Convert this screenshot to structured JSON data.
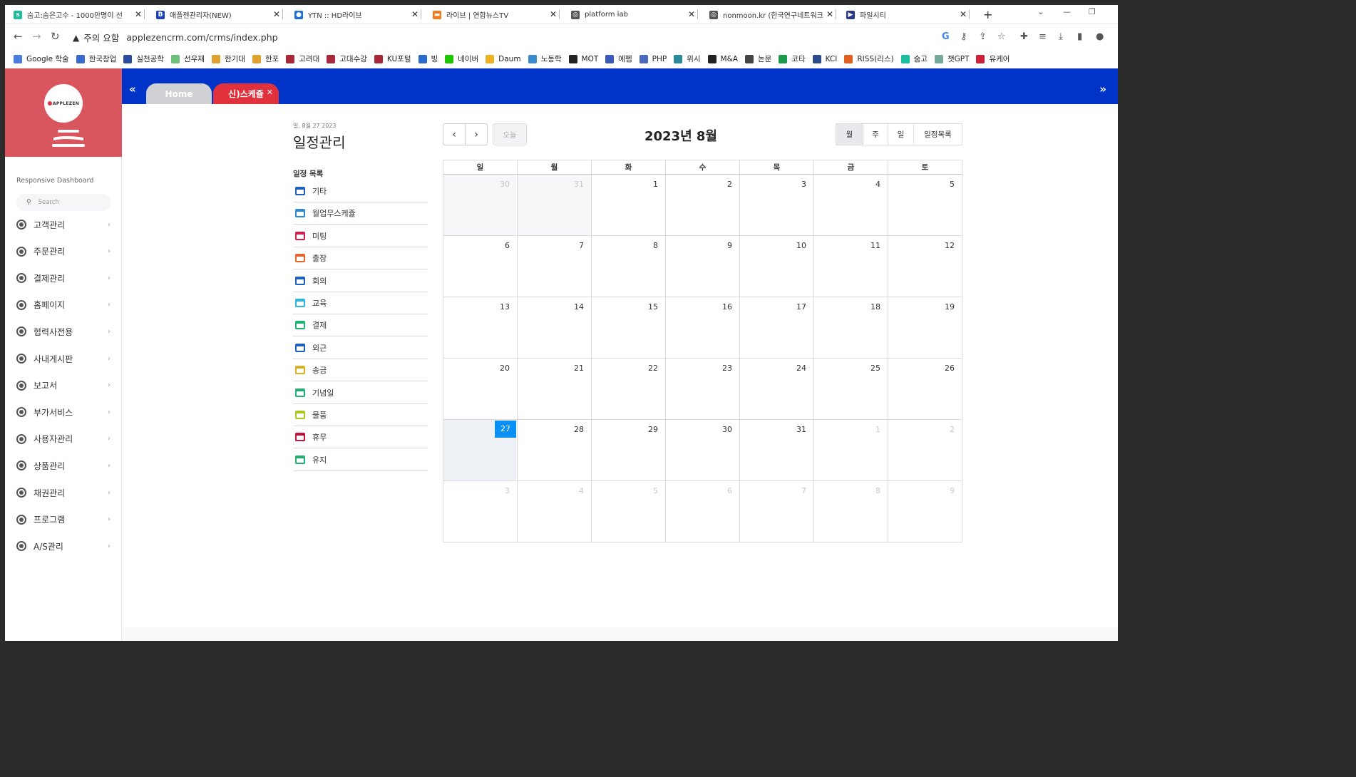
{
  "browser": {
    "tabs": [
      {
        "title": "숨고:숨은고수 - 1000만명이 선",
        "fav_color": "#1cbf9b",
        "fav_glyph": "s"
      },
      {
        "title": "애플젠관리자(NEW)",
        "fav_color": "#1a3fbf",
        "fav_glyph": "B"
      },
      {
        "title": "YTN :: HD라이브",
        "fav_color": "#1b6fd8",
        "fav_glyph": "●"
      },
      {
        "title": "라이브 | 연합뉴스TV",
        "fav_color": "#f07a1c",
        "fav_glyph": "▬"
      },
      {
        "title": "platform lab",
        "fav_color": "#555555",
        "fav_glyph": "◎"
      },
      {
        "title": "nonmoon.kr (한국연구네트워크",
        "fav_color": "#555555",
        "fav_glyph": "◎"
      },
      {
        "title": "파일시티",
        "fav_color": "#2a3a8a",
        "fav_glyph": "▶"
      }
    ],
    "security_label": "주의 요함",
    "url": "applezencrm.com/crms/index.php",
    "bookmarks": [
      {
        "label": "Google 학술",
        "color": "#4a7de0"
      },
      {
        "label": "한국창업",
        "color": "#3a6ad0"
      },
      {
        "label": "실천공학",
        "color": "#2a4aa0"
      },
      {
        "label": "선우재",
        "color": "#6cc07a"
      },
      {
        "label": "한기대",
        "color": "#e0a030"
      },
      {
        "label": "한포",
        "color": "#e0a030"
      },
      {
        "label": "고려대",
        "color": "#a8283a"
      },
      {
        "label": "고대수강",
        "color": "#a8283a"
      },
      {
        "label": "KU포털",
        "color": "#a8283a"
      },
      {
        "label": "빙",
        "color": "#2a6ad0"
      },
      {
        "label": "네이버",
        "color": "#1ec800"
      },
      {
        "label": "Daum",
        "color": "#f0b020"
      },
      {
        "label": "노동학",
        "color": "#3a8ad0"
      },
      {
        "label": "MOT",
        "color": "#222222"
      },
      {
        "label": "에펨",
        "color": "#3a5ac0"
      },
      {
        "label": "PHP",
        "color": "#4a6ac0"
      },
      {
        "label": "위시",
        "color": "#2a8a9a"
      },
      {
        "label": "M&A",
        "color": "#222222"
      },
      {
        "label": "논문",
        "color": "#444444"
      },
      {
        "label": "코타",
        "color": "#1a9a4a"
      },
      {
        "label": "KCI",
        "color": "#2a4a8a"
      },
      {
        "label": "RISS(리스)",
        "color": "#e06020"
      },
      {
        "label": "숨고",
        "color": "#1cbf9b"
      },
      {
        "label": "챗GPT",
        "color": "#74aa9c"
      },
      {
        "label": "유케어",
        "color": "#d0203a"
      }
    ]
  },
  "sidebar": {
    "brand_text": "APPLEZEN",
    "title": "Responsive Dashboard",
    "search_placeholder": "Search",
    "items": [
      {
        "label": "고객관리"
      },
      {
        "label": "주문관리"
      },
      {
        "label": "결제관리"
      },
      {
        "label": "홈페이지"
      },
      {
        "label": "협력사전용"
      },
      {
        "label": "사내게시판"
      },
      {
        "label": "보고서"
      },
      {
        "label": "부가서비스"
      },
      {
        "label": "사용자관리"
      },
      {
        "label": "상품관리"
      },
      {
        "label": "채권관리"
      },
      {
        "label": "프로그램"
      },
      {
        "label": "A/S관리"
      }
    ]
  },
  "app_tabs": {
    "home": "Home",
    "schedule": "신)스케쥴"
  },
  "schedule": {
    "date_line": "일, 8월 27 2023",
    "title": "일정관리",
    "list_title": "일정 목록",
    "categories": [
      {
        "label": "기타",
        "color": "#1f5fbf"
      },
      {
        "label": "월업무스케쥴",
        "color": "#2a8ad8"
      },
      {
        "label": "미팅",
        "color": "#d81b4a"
      },
      {
        "label": "출장",
        "color": "#e8602a"
      },
      {
        "label": "회의",
        "color": "#1f5fbf"
      },
      {
        "label": "교육",
        "color": "#29b6e0"
      },
      {
        "label": "결제",
        "color": "#20b070"
      },
      {
        "label": "외근",
        "color": "#1f5fbf"
      },
      {
        "label": "송금",
        "color": "#d8b020"
      },
      {
        "label": "기념일",
        "color": "#20b070"
      },
      {
        "label": "물품",
        "color": "#a8c820"
      },
      {
        "label": "휴무",
        "color": "#c8103a"
      },
      {
        "label": "유지",
        "color": "#20b070"
      }
    ]
  },
  "calendar": {
    "today_label": "오늘",
    "title": "2023년 8월",
    "views": [
      "월",
      "주",
      "일",
      "일정목록"
    ],
    "active_view": "월",
    "weekdays": [
      "일",
      "월",
      "화",
      "수",
      "목",
      "금",
      "토"
    ],
    "weeks": [
      [
        {
          "d": "30",
          "t": "prev"
        },
        {
          "d": "31",
          "t": "prev"
        },
        {
          "d": "1"
        },
        {
          "d": "2"
        },
        {
          "d": "3"
        },
        {
          "d": "4"
        },
        {
          "d": "5"
        }
      ],
      [
        {
          "d": "6"
        },
        {
          "d": "7"
        },
        {
          "d": "8"
        },
        {
          "d": "9"
        },
        {
          "d": "10"
        },
        {
          "d": "11"
        },
        {
          "d": "12"
        }
      ],
      [
        {
          "d": "13"
        },
        {
          "d": "14"
        },
        {
          "d": "15"
        },
        {
          "d": "16"
        },
        {
          "d": "17"
        },
        {
          "d": "18"
        },
        {
          "d": "19"
        }
      ],
      [
        {
          "d": "20"
        },
        {
          "d": "21"
        },
        {
          "d": "22"
        },
        {
          "d": "23"
        },
        {
          "d": "24"
        },
        {
          "d": "25"
        },
        {
          "d": "26"
        }
      ],
      [
        {
          "d": "27",
          "t": "today"
        },
        {
          "d": "28"
        },
        {
          "d": "29"
        },
        {
          "d": "30"
        },
        {
          "d": "31"
        },
        {
          "d": "1",
          "t": "next"
        },
        {
          "d": "2",
          "t": "next"
        }
      ],
      [
        {
          "d": "3",
          "t": "next"
        },
        {
          "d": "4",
          "t": "next"
        },
        {
          "d": "5",
          "t": "next"
        },
        {
          "d": "6",
          "t": "next"
        },
        {
          "d": "7",
          "t": "next"
        },
        {
          "d": "8",
          "t": "next"
        },
        {
          "d": "9",
          "t": "next"
        }
      ]
    ]
  }
}
